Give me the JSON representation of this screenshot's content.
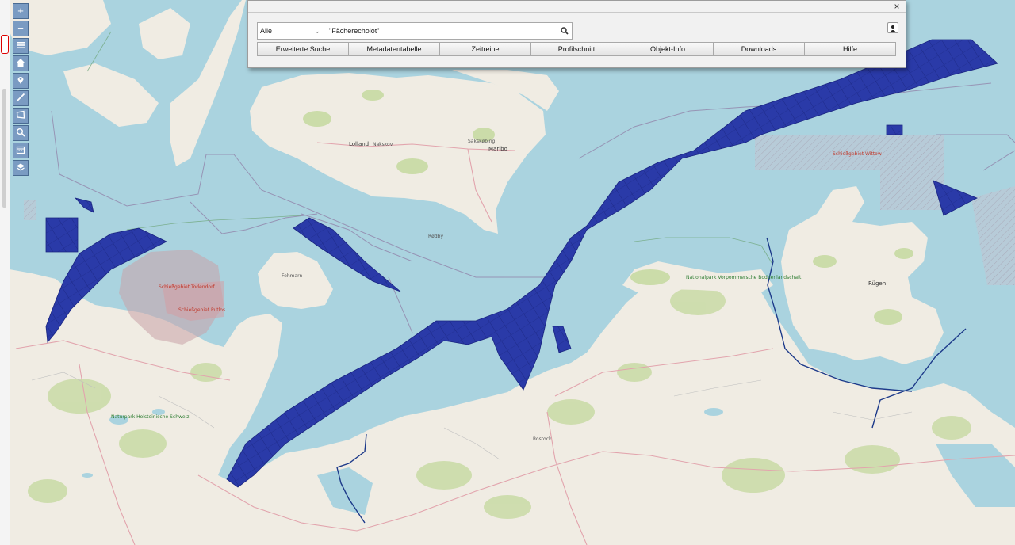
{
  "toolbar": {
    "zoom_in": "+",
    "zoom_out": "−",
    "icons": [
      "menu-icon",
      "home-icon",
      "map-pin-icon",
      "measure-line-icon",
      "polygon-icon",
      "zoom-area-icon",
      "calendar-icon",
      "layers-icon"
    ]
  },
  "search": {
    "category": "Alle",
    "query": "\"Fächerecholot\""
  },
  "panel": {
    "close": "×",
    "tabs": [
      "Erweiterte Suche",
      "Metadatentabelle",
      "Zeitreihe",
      "Profilschnitt",
      "Objekt-Info",
      "Downloads",
      "Hilfe"
    ]
  },
  "map": {
    "labels": {
      "lolland": "Lolland",
      "nakskov": "Nakskov",
      "maribo": "Maribo",
      "rodby": "Rødby",
      "sakskobing": "Sakskøbing",
      "rugen": "Rügen",
      "rostock": "Rostock",
      "fehmarn": "Fehmarn",
      "nationalpark": "Nationalpark Vorpommersche Boddenlandschaft",
      "schleswig": "Naturpark Holsteinische Schweiz",
      "restricted1": "Schießgebiet Todendorf",
      "restricted2": "Schießgebiet Putlos",
      "restricted3": "Schießgebiet Wittow"
    }
  },
  "colors": {
    "sea": "#aad3df",
    "land": "#f2efe9",
    "forest": "#c8dba5",
    "survey": "#2233aa",
    "restricted": "#c9a3a8"
  }
}
